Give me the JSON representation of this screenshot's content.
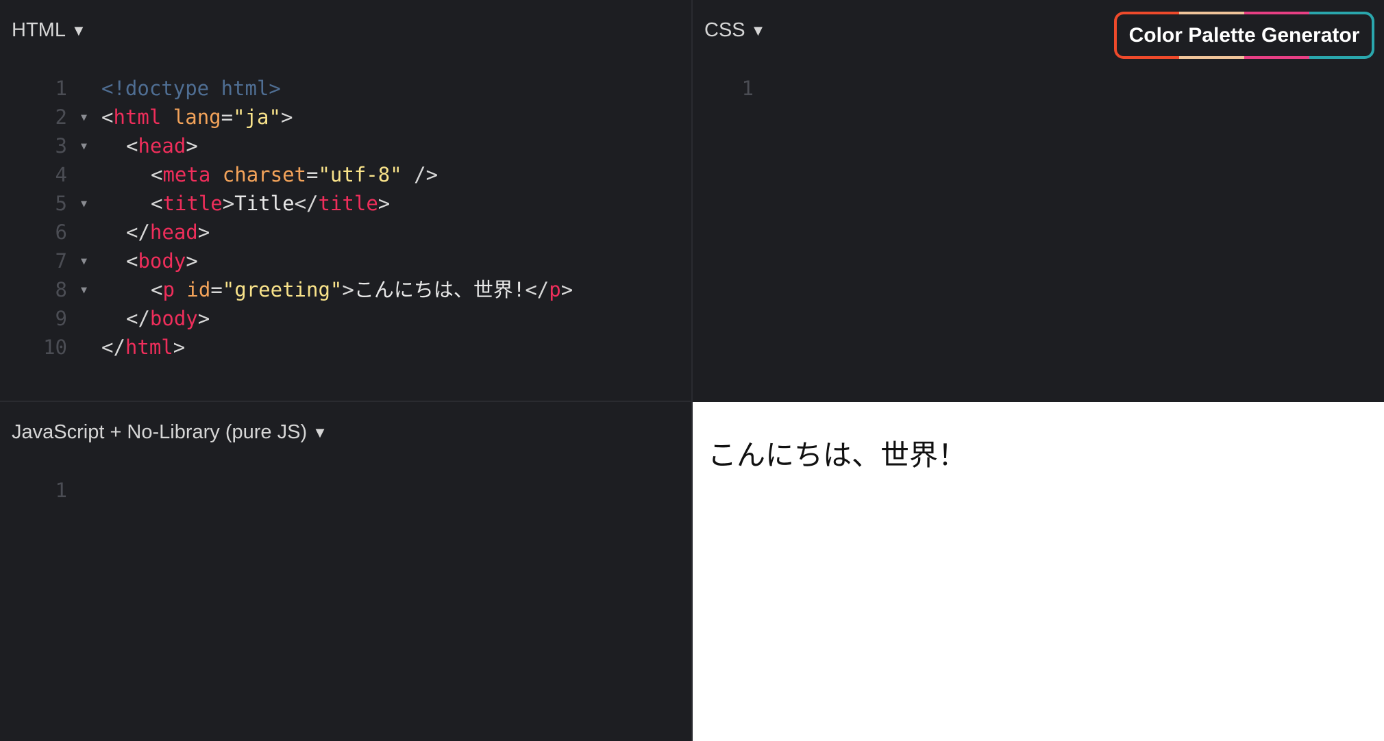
{
  "panes": {
    "html": {
      "header": "HTML"
    },
    "css": {
      "header": "CSS"
    },
    "js": {
      "header": "JavaScript + No-Library (pure JS)"
    }
  },
  "palette_button": {
    "label": "Color Palette Generator"
  },
  "html_code": {
    "lines": [
      {
        "n": "1",
        "fold": false,
        "indent": 0,
        "tokens": [
          [
            "doc",
            "<!doctype html>"
          ]
        ]
      },
      {
        "n": "2",
        "fold": true,
        "indent": 0,
        "tokens": [
          [
            "br",
            "<"
          ],
          [
            "tag",
            "html"
          ],
          [
            "txt",
            " "
          ],
          [
            "attr",
            "lang"
          ],
          [
            "br",
            "="
          ],
          [
            "str",
            "\"ja\""
          ],
          [
            "br",
            ">"
          ]
        ]
      },
      {
        "n": "3",
        "fold": true,
        "indent": 1,
        "tokens": [
          [
            "br",
            "<"
          ],
          [
            "tag",
            "head"
          ],
          [
            "br",
            ">"
          ]
        ]
      },
      {
        "n": "4",
        "fold": false,
        "indent": 2,
        "tokens": [
          [
            "br",
            "<"
          ],
          [
            "tag",
            "meta"
          ],
          [
            "txt",
            " "
          ],
          [
            "attr",
            "charset"
          ],
          [
            "br",
            "="
          ],
          [
            "str",
            "\"utf-8\""
          ],
          [
            "br",
            " />"
          ]
        ]
      },
      {
        "n": "5",
        "fold": true,
        "indent": 2,
        "tokens": [
          [
            "br",
            "<"
          ],
          [
            "tag",
            "title"
          ],
          [
            "br",
            ">"
          ],
          [
            "txt",
            "Title"
          ],
          [
            "br",
            "</"
          ],
          [
            "tag",
            "title"
          ],
          [
            "br",
            ">"
          ]
        ]
      },
      {
        "n": "6",
        "fold": false,
        "indent": 1,
        "tokens": [
          [
            "br",
            "</"
          ],
          [
            "tag",
            "head"
          ],
          [
            "br",
            ">"
          ]
        ]
      },
      {
        "n": "7",
        "fold": true,
        "indent": 1,
        "tokens": [
          [
            "br",
            "<"
          ],
          [
            "tag",
            "body"
          ],
          [
            "br",
            ">"
          ]
        ]
      },
      {
        "n": "8",
        "fold": true,
        "indent": 2,
        "tokens": [
          [
            "br",
            "<"
          ],
          [
            "tag",
            "p"
          ],
          [
            "txt",
            " "
          ],
          [
            "attr",
            "id"
          ],
          [
            "br",
            "="
          ],
          [
            "str",
            "\"greeting\""
          ],
          [
            "br",
            ">"
          ],
          [
            "txt",
            "こんにちは、世界!"
          ],
          [
            "br",
            "</"
          ],
          [
            "tag",
            "p"
          ],
          [
            "br",
            ">"
          ]
        ]
      },
      {
        "n": "9",
        "fold": false,
        "indent": 1,
        "tokens": [
          [
            "br",
            "</"
          ],
          [
            "tag",
            "body"
          ],
          [
            "br",
            ">"
          ]
        ]
      },
      {
        "n": "10",
        "fold": false,
        "indent": 0,
        "tokens": [
          [
            "br",
            "</"
          ],
          [
            "tag",
            "html"
          ],
          [
            "br",
            ">"
          ]
        ]
      }
    ]
  },
  "css_code": {
    "lines": [
      {
        "n": "1"
      }
    ]
  },
  "js_code": {
    "lines": [
      {
        "n": "1"
      }
    ]
  },
  "output": {
    "text": "こんにちは、世界！"
  },
  "colors": {
    "editor_bg": "#1d1e22",
    "tag": "#ef2e5b",
    "attr": "#f3a35a",
    "string": "#f9e38a",
    "doctype": "#4f6e93",
    "palette": [
      "#ef4a2b",
      "#f0c49a",
      "#e83f84",
      "#2aa7ad"
    ]
  }
}
